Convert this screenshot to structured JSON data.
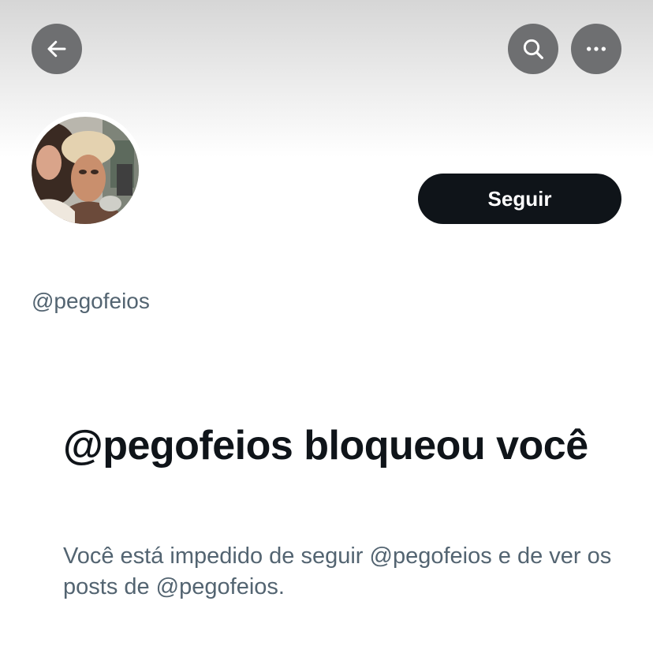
{
  "header": {
    "back_icon": "arrow-left-icon",
    "search_icon": "search-icon",
    "more_icon": "more-horizontal-icon",
    "icon_color": "#ffffff",
    "button_bg": "#6e6f71"
  },
  "profile": {
    "handle": "@pegofeios",
    "follow_label": "Seguir",
    "follow_bg": "#0f1419"
  },
  "blocked_notice": {
    "title": "@pegofeios bloqueou você",
    "description": "Você está impedido de seguir @pegofeios e de ver os posts de @pegofeios."
  }
}
